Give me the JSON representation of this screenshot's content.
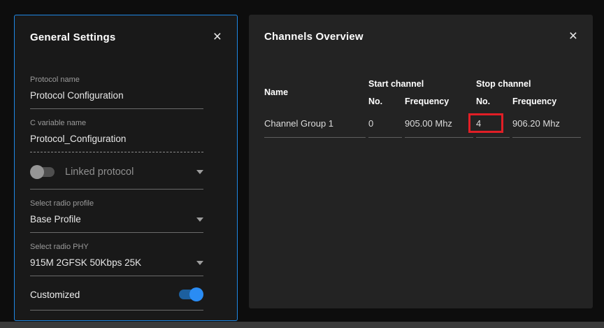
{
  "general_settings": {
    "title": "General Settings",
    "close": "×",
    "protocol_name": {
      "label": "Protocol name",
      "value": "Protocol Configuration"
    },
    "c_variable_name": {
      "label": "C variable name",
      "value": "Protocol_Configuration"
    },
    "linked_protocol": {
      "label": "Linked protocol",
      "state": "off"
    },
    "radio_profile": {
      "label": "Select radio profile",
      "value": "Base Profile"
    },
    "radio_phy": {
      "label": "Select radio PHY",
      "value": "915M 2GFSK 50Kbps 25K"
    },
    "customized": {
      "label": "Customized",
      "state": "on"
    }
  },
  "channels_overview": {
    "title": "Channels Overview",
    "close": "×",
    "table": {
      "headers": {
        "name": "Name",
        "start_channel": "Start channel",
        "stop_channel": "Stop channel",
        "no": "No.",
        "frequency": "Frequency"
      },
      "rows": [
        {
          "name": "Channel Group 1",
          "start_no": "0",
          "start_frequency": "905.00 Mhz",
          "stop_no": "4",
          "stop_frequency": "906.20 Mhz"
        }
      ]
    },
    "highlight": {
      "cell": "stop_no",
      "color": "#e11e26"
    }
  },
  "colors": {
    "accent_border": "#1e88e5",
    "toggle_on": "#2a8cf4",
    "highlight_red": "#e11e26"
  }
}
